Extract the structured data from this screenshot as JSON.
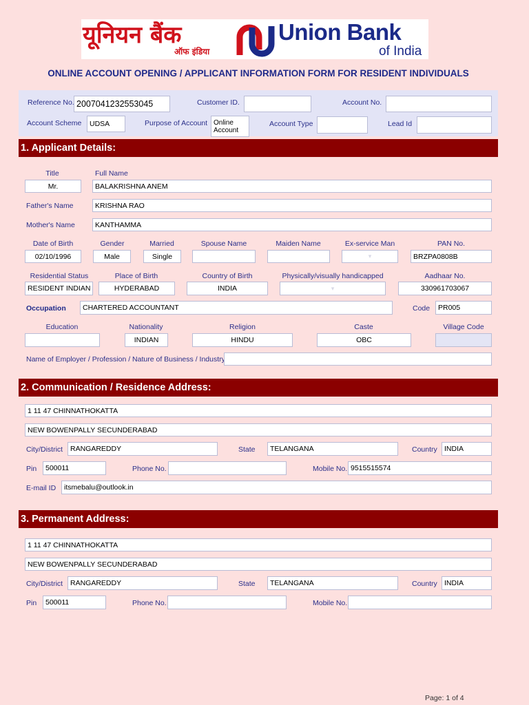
{
  "header": {
    "hindi_logo": "यूनियन बैंक",
    "hindi_sub": "ऑफ इंडिया",
    "brand_line1": "Union Bank",
    "brand_line2": "of India",
    "form_title": "ONLINE ACCOUNT OPENING / APPLICANT INFORMATION FORM FOR RESIDENT INDIVIDUALS",
    "brand_colors": {
      "red": "#d0121c",
      "blue": "#1b2a88"
    }
  },
  "top": {
    "reference_label": "Reference No.",
    "reference_value": "2007041232553045",
    "customer_id_label": "Customer ID.",
    "customer_id_value": "",
    "account_no_label": "Account No.",
    "account_no_value": "",
    "scheme_label": "Account Scheme",
    "scheme_value": "UDSA",
    "purpose_label": "Purpose of Account",
    "purpose_value": "Online Account",
    "type_label": "Account Type",
    "type_value": "",
    "lead_label": "Lead Id",
    "lead_value": ""
  },
  "section1": {
    "heading": "1. Applicant Details:",
    "title_label": "Title",
    "title_value": "Mr.",
    "fullname_label": "Full Name",
    "fullname_value": "BALAKRISHNA ANEM",
    "father_label": "Father's Name",
    "father_value": "KRISHNA RAO",
    "mother_label": "Mother's Name",
    "mother_value": "KANTHAMMA",
    "dob_label": "Date of Birth",
    "dob_value": "02/10/1996",
    "gender_label": "Gender",
    "gender_value": "Male",
    "married_label": "Married",
    "married_value": "Single",
    "spouse_label": "Spouse Name",
    "spouse_value": "",
    "maiden_label": "Maiden Name",
    "maiden_value": "",
    "exservice_label": "Ex-service Man",
    "exservice_value": "",
    "pan_label": "PAN No.",
    "pan_value": "BRZPA0808B",
    "residential_label": "Residential Status",
    "residential_value": "RESIDENT INDIAN",
    "pob_label": "Place of Birth",
    "pob_value": "HYDERABAD",
    "cob_label": "Country of Birth",
    "cob_value": "INDIA",
    "handicap_label": "Physically/visually handicapped",
    "handicap_value": "",
    "aadhaar_label": "Aadhaar No.",
    "aadhaar_value": "330961703067",
    "occupation_label": "Occupation",
    "occupation_value": "CHARTERED ACCOUNTANT",
    "code_label": "Code",
    "code_value": "PR005",
    "education_label": "Education",
    "education_value": "",
    "nationality_label": "Nationality",
    "nationality_value": "INDIAN",
    "religion_label": "Religion",
    "religion_value": "HINDU",
    "caste_label": "Caste",
    "caste_value": "OBC",
    "village_label": "Village Code",
    "village_value": "",
    "employer_label": "Name of Employer / Profession / Nature of Business / Industry",
    "employer_value": ""
  },
  "section2": {
    "heading": "2. Communication / Residence Address:",
    "line1": "1 11 47 CHINNATHOKATTA",
    "line2": "NEW BOWENPALLY SECUNDERABAD",
    "city_label": "City/District",
    "city_value": "RANGAREDDY",
    "state_label": "State",
    "state_value": "TELANGANA",
    "country_label": "Country",
    "country_value": "INDIA",
    "pin_label": "Pin",
    "pin_value": "500011",
    "phone_label": "Phone No.",
    "phone_value": "",
    "mobile_label": "Mobile No.",
    "mobile_value": "9515515574",
    "email_label": "E-mail ID",
    "email_value": "itsmebalu@outlook.in"
  },
  "section3": {
    "heading": "3. Permanent Address:",
    "line1": "1 11 47 CHINNATHOKATTA",
    "line2": "NEW BOWENPALLY SECUNDERABAD",
    "city_label": "City/District",
    "city_value": "RANGAREDDY",
    "state_label": "State",
    "state_value": "TELANGANA",
    "country_label": "Country",
    "country_value": "INDIA",
    "pin_label": "Pin",
    "pin_value": "500011",
    "phone_label": "Phone No.",
    "phone_value": "",
    "mobile_label": "Mobile No.",
    "mobile_value": ""
  },
  "footer": {
    "page": "Page: 1 of 4"
  }
}
